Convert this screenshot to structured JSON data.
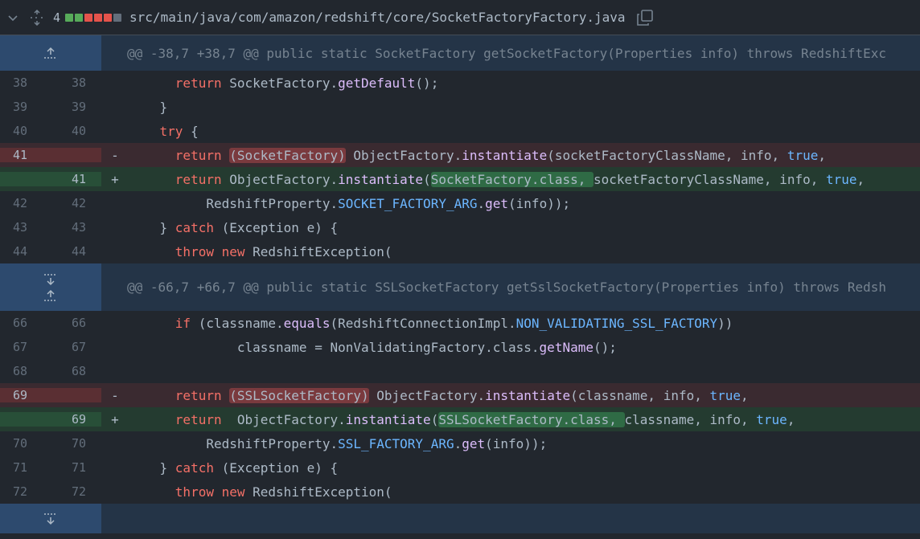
{
  "file": {
    "changes": "4",
    "path": "src/main/java/com/amazon/redshift/core/SocketFactoryFactory.java",
    "diffstat_colors": [
      "#57ab5a",
      "#57ab5a",
      "#e5534b",
      "#e5534b",
      "#e5534b",
      "#636e7b"
    ]
  },
  "hunks": [
    {
      "header": "@@ -38,7 +38,7 @@ public static SocketFactory getSocketFactory(Properties info) throws RedshiftExc"
    },
    {
      "header": "@@ -66,7 +66,7 @@ public static SSLSocketFactory getSslSocketFactory(Properties info) throws Redsh"
    }
  ],
  "lines": {
    "l38": {
      "left": "38",
      "right": "38"
    },
    "l39": {
      "left": "39",
      "right": "39"
    },
    "l40": {
      "left": "40",
      "right": "40"
    },
    "l41d": {
      "left": "41",
      "sign": "-"
    },
    "l41a": {
      "right": "41",
      "sign": "+"
    },
    "l42": {
      "left": "42",
      "right": "42"
    },
    "l43": {
      "left": "43",
      "right": "43"
    },
    "l44": {
      "left": "44",
      "right": "44"
    },
    "l66": {
      "left": "66",
      "right": "66"
    },
    "l67": {
      "left": "67",
      "right": "67"
    },
    "l68": {
      "left": "68",
      "right": "68"
    },
    "l69d": {
      "left": "69",
      "sign": "-"
    },
    "l69a": {
      "right": "69",
      "sign": "+"
    },
    "l70": {
      "left": "70",
      "right": "70"
    },
    "l71": {
      "left": "71",
      "right": "71"
    },
    "l72": {
      "left": "72",
      "right": "72"
    }
  },
  "code": {
    "c38a": "return",
    "c38b": " SocketFactory.",
    "c38c": "getDefault",
    "c38d": "();",
    "c39": "}",
    "c40a": "try",
    "c40b": " {",
    "c41da": "return",
    "c41db": " ",
    "c41dc": "(SocketFactory)",
    "c41dd": " ObjectFactory.",
    "c41de": "instantiate",
    "c41df": "(socketFactoryClassName, info, ",
    "c41dg": "true",
    "c41dh": ",",
    "c41aa": "return",
    "c41ab": " ObjectFactory.",
    "c41ac": "instantiate",
    "c41ad": "(",
    "c41ae": "SocketFactory.class, ",
    "c41af": "socketFactoryClassName, info, ",
    "c41ag": "true",
    "c41ah": ",",
    "c42a": "RedshiftProperty.",
    "c42b": "SOCKET_FACTORY_ARG",
    "c42c": ".",
    "c42d": "get",
    "c42e": "(info));",
    "c43a": "} ",
    "c43b": "catch",
    "c43c": " (Exception e) {",
    "c44a": "throw",
    "c44b": " ",
    "c44c": "new",
    "c44d": " RedshiftException(",
    "c66a": "if",
    "c66b": " (classname.",
    "c66c": "equals",
    "c66d": "(RedshiftConnectionImpl.",
    "c66e": "NON_VALIDATING_SSL_FACTORY",
    "c66f": "))",
    "c67a": "classname = NonValidatingFactory.class.",
    "c67b": "getName",
    "c67c": "();",
    "c69da": "return",
    "c69db": " ",
    "c69dc": "(SSLSocketFactory)",
    "c69dd": " ObjectFactory.",
    "c69de": "instantiate",
    "c69df": "(classname, info, ",
    "c69dg": "true",
    "c69dh": ",",
    "c69aa": "return",
    "c69ab": "  ObjectFactory.",
    "c69ac": "instantiate",
    "c69ad": "(",
    "c69ae": "SSLSocketFactory.class, ",
    "c69af": "classname, info, ",
    "c69ag": "true",
    "c69ah": ",",
    "c70a": "RedshiftProperty.",
    "c70b": "SSL_FACTORY_ARG",
    "c70c": ".",
    "c70d": "get",
    "c70e": "(info));",
    "c71a": "} ",
    "c71b": "catch",
    "c71c": " (Exception e) {",
    "c72a": "throw",
    "c72b": " ",
    "c72c": "new",
    "c72d": " RedshiftException("
  }
}
